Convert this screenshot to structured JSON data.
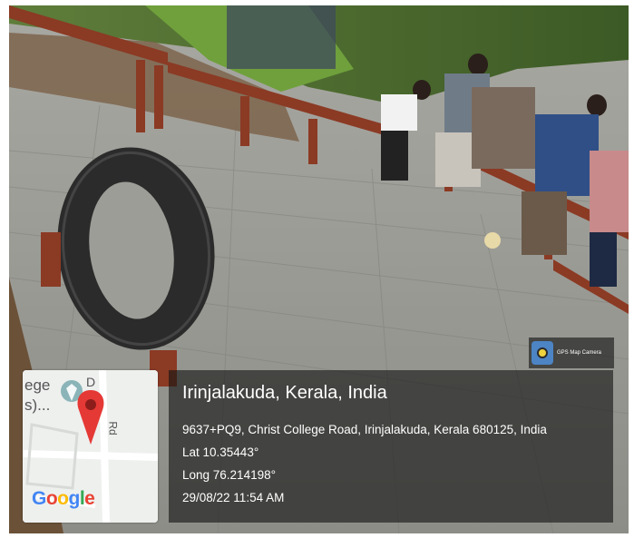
{
  "overlay": {
    "app_badge": "GPS Map Camera",
    "title": "Irinjalakuda, Kerala, India",
    "address": "9637+PQ9, Christ College Road, Irinjalakuda, Kerala 680125, India",
    "latitude": "Lat 10.35443°",
    "longitude": "Long 76.214198°",
    "timestamp": "29/08/22 11:54 AM"
  },
  "map": {
    "label_top_left": "ege",
    "label_second": "s)...",
    "road_label": "D",
    "road_label_2": "Rd",
    "logo": "Google",
    "logo_colors": [
      "#4285F4",
      "#EA4335",
      "#FBBC05",
      "#4285F4",
      "#34A853",
      "#EA4335"
    ],
    "pin_color": "#E53935"
  },
  "icons": {
    "map_pin": "map-pin-icon",
    "camera": "gps-map-camera-icon",
    "place": "place-marker-icon"
  }
}
